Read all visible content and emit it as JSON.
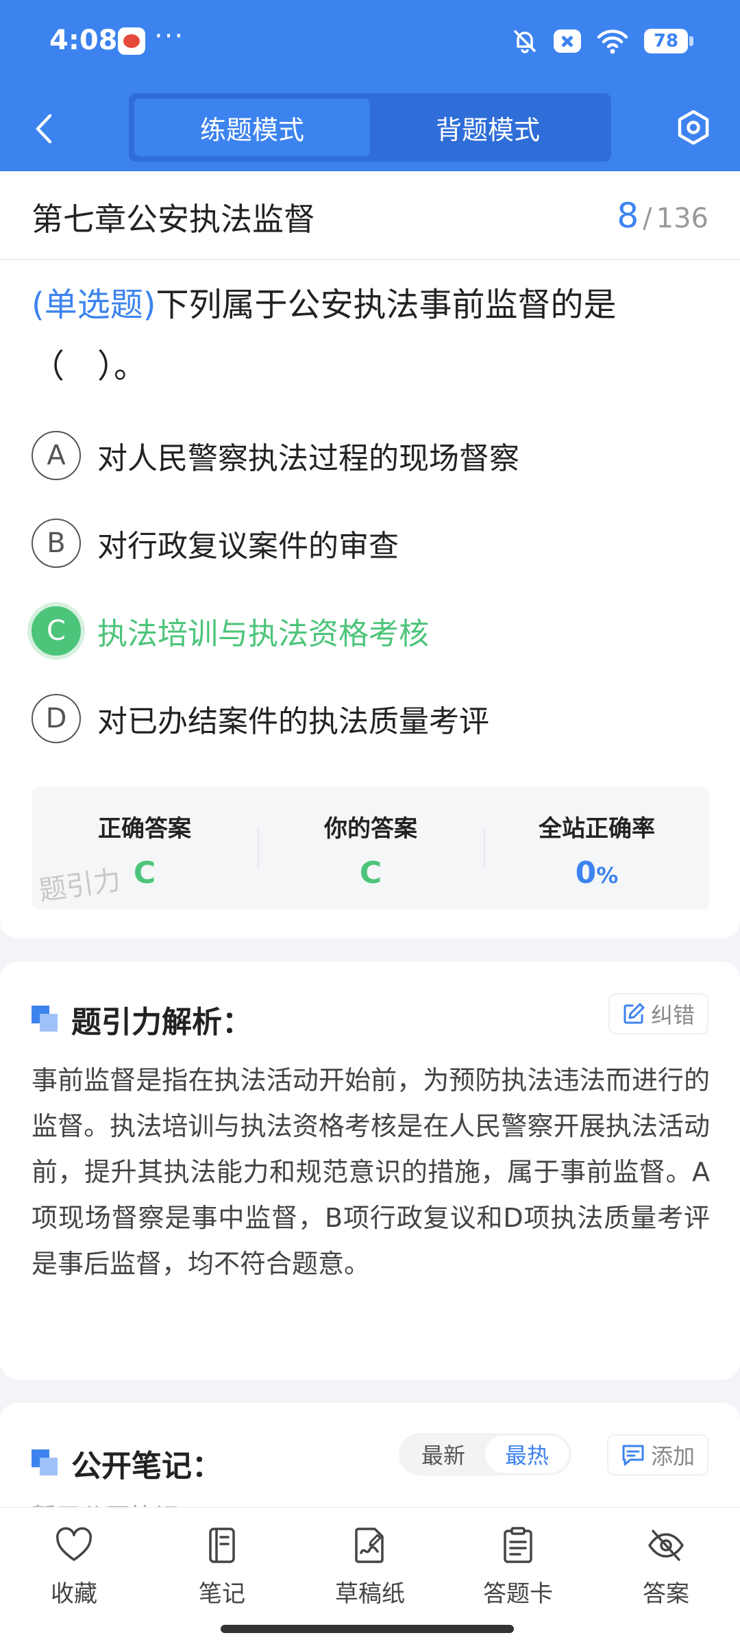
{
  "status": {
    "time": "4:08",
    "dots": "···",
    "battery": "78"
  },
  "nav": {
    "tabs": [
      {
        "label": "练题模式"
      },
      {
        "label": "背题模式"
      }
    ]
  },
  "chapter": {
    "title": "第七章公安执法监督",
    "current": "8",
    "total": "136"
  },
  "question": {
    "type": "(单选题)",
    "text": "下列属于公安执法事前监督的是（　）。",
    "options": [
      {
        "letter": "A",
        "text": "对人民警察执法过程的现场督察"
      },
      {
        "letter": "B",
        "text": "对行政复议案件的审查"
      },
      {
        "letter": "C",
        "text": "执法培训与执法资格考核"
      },
      {
        "letter": "D",
        "text": "对已办结案件的执法质量考评"
      }
    ]
  },
  "answer": {
    "correct_label": "正确答案",
    "correct_value": "C",
    "yours_label": "你的答案",
    "yours_value": "C",
    "rate_label": "全站正确率",
    "rate_value": "0",
    "rate_unit": "%",
    "watermark": "题引力"
  },
  "analysis": {
    "title": "题引力解析：",
    "report_label": "纠错",
    "text": "事前监督是指在执法活动开始前，为预防执法违法而进行的监督。执法培训与执法资格考核是在人民警察开展执法活动前，提升其执法能力和规范意识的措施，属于事前监督。A项现场督察是事中监督，B项行政复议和D项执法质量考评是事后监督，均不符合题意。"
  },
  "notes": {
    "title": "公开笔记：",
    "sort_latest": "最新",
    "sort_hot": "最热",
    "add_label": "添加",
    "empty_text": "暂无公开笔记"
  },
  "bottom_bar": [
    {
      "label": "收藏",
      "icon": "heart-icon"
    },
    {
      "label": "笔记",
      "icon": "notebook-icon"
    },
    {
      "label": "草稿纸",
      "icon": "draft-icon"
    },
    {
      "label": "答题卡",
      "icon": "answer-sheet-icon"
    },
    {
      "label": "答案",
      "icon": "eye-off-icon"
    }
  ],
  "colors": {
    "primary": "#3c83ef",
    "correct": "#4cc47a"
  }
}
